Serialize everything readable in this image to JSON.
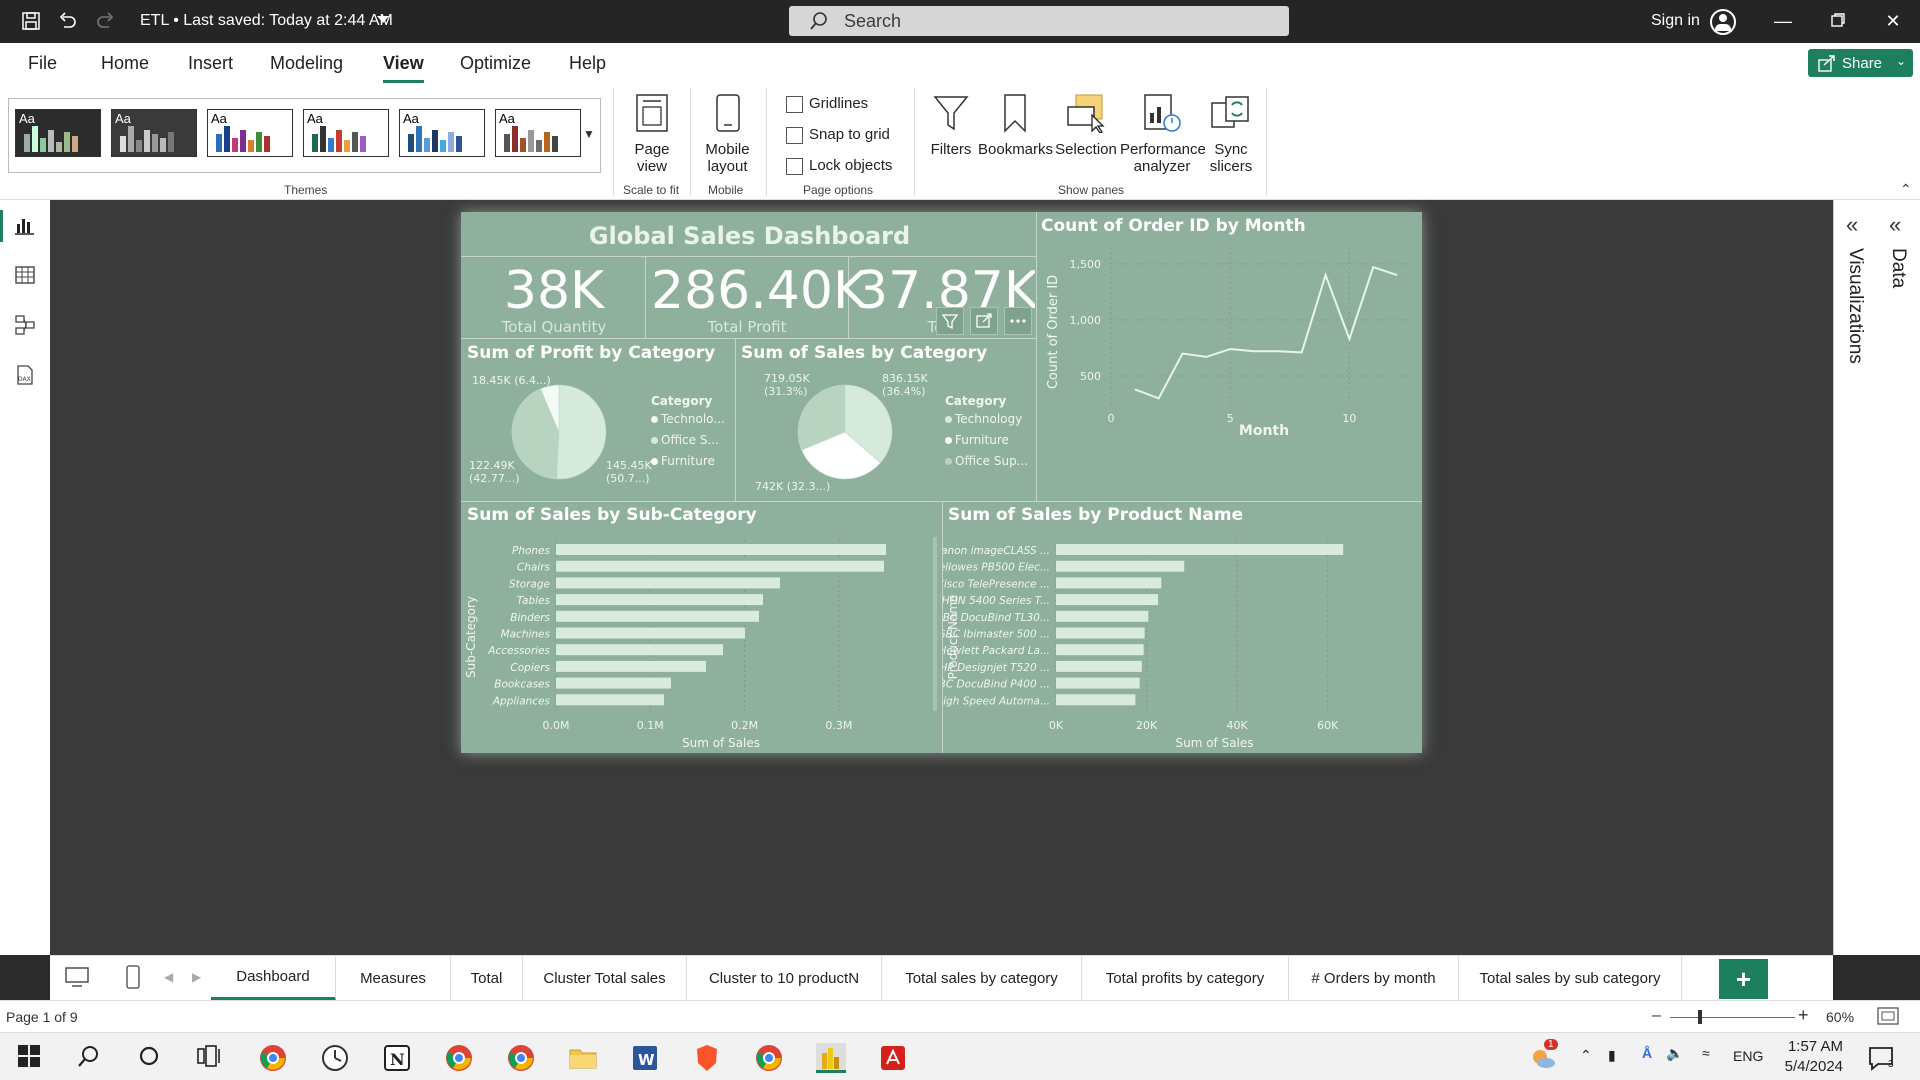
{
  "titlebar": {
    "doc_title": "ETL  •  Last saved: Today at 2:44 AM",
    "search_placeholder": "Search",
    "sign_in": "Sign in"
  },
  "ribbon": {
    "tabs": [
      "File",
      "Home",
      "Insert",
      "Modeling",
      "View",
      "Optimize",
      "Help"
    ],
    "active_tab": "View",
    "share_label": "Share",
    "theme_label": "Aa",
    "groups": {
      "themes": "Themes",
      "scale_to_fit": "Scale to fit",
      "mobile": "Mobile",
      "page_options": "Page options",
      "show_panes": "Show panes"
    },
    "page_view": "Page view",
    "mobile_layout": "Mobile layout",
    "checkboxes": [
      "Gridlines",
      "Snap to grid",
      "Lock objects"
    ],
    "panes": [
      "Filters",
      "Bookmarks",
      "Selection",
      "Performance analyzer",
      "Sync slicers"
    ]
  },
  "right_panes": {
    "visualizations": "Visualizations",
    "data": "Data"
  },
  "report": {
    "title": "Global Sales Dashboard",
    "kpis": [
      {
        "value": "38K",
        "label": "Total Quantity"
      },
      {
        "value": "286.40K",
        "label": "Total Profit"
      },
      {
        "value": "37.87K",
        "label": "Total"
      }
    ],
    "profit_by_category": {
      "title": "Sum of Profit by Category",
      "legend_title": "Category",
      "legend": [
        "Technolo...",
        "Office S...",
        "Furniture"
      ],
      "labels": [
        "18.45K (6.4...)",
        "122.49K (42.77...)",
        "145.45K (50.7...)"
      ]
    },
    "sales_by_category": {
      "title": "Sum of Sales by Category",
      "legend_title": "Category",
      "legend": [
        "Technology",
        "Furniture",
        "Office Sup..."
      ],
      "labels": [
        "719.05K (31.3%)",
        "836.15K (36.4%)",
        "742K (32.3...)"
      ]
    },
    "orders_by_month": {
      "title": "Count of Order ID by Month",
      "xlabel": "Month",
      "ylabel": "Count of Order ID",
      "yticks": [
        "1,500",
        "1,000",
        "500"
      ],
      "xticks": [
        "0",
        "5",
        "10"
      ]
    },
    "sales_by_subcategory": {
      "title": "Sum of Sales by Sub-Category",
      "xlabel": "Sum of Sales",
      "ylabel": "Sub-Category",
      "xticks": [
        "0.0M",
        "0.1M",
        "0.2M",
        "0.3M"
      ]
    },
    "sales_by_product": {
      "title": "Sum of Sales by Product Name",
      "xlabel": "Sum of Sales",
      "ylabel": "Product Name",
      "xticks": [
        "0K",
        "20K",
        "40K",
        "60K"
      ]
    }
  },
  "chart_data": [
    {
      "type": "pie",
      "title": "Sum of Profit by Category",
      "categories": [
        "Technology",
        "Office Supplies",
        "Furniture"
      ],
      "values": [
        145450,
        122490,
        18450
      ]
    },
    {
      "type": "pie",
      "title": "Sum of Sales by Category",
      "categories": [
        "Technology",
        "Furniture",
        "Office Supplies"
      ],
      "values": [
        836150,
        742000,
        719050
      ]
    },
    {
      "type": "line",
      "title": "Count of Order ID by Month",
      "xlabel": "Month",
      "ylabel": "Count of Order ID",
      "x": [
        1,
        2,
        3,
        4,
        5,
        6,
        7,
        8,
        9,
        10,
        11,
        12
      ],
      "values": [
        380,
        300,
        700,
        670,
        740,
        720,
        720,
        710,
        1400,
        830,
        1470,
        1400
      ],
      "xlim": [
        0,
        12.5
      ],
      "ylim": [
        250,
        1650
      ]
    },
    {
      "type": "bar",
      "orientation": "horizontal",
      "title": "Sum of Sales by Sub-Category",
      "xlabel": "Sum of Sales",
      "ylabel": "Sub-Category",
      "categories": [
        "Phones",
        "Chairs",
        "Storage",
        "Tables",
        "Binders",
        "Machines",
        "Accessories",
        "Copiers",
        "Bookcases",
        "Appliances"
      ],
      "values": [
        330000,
        328000,
        224000,
        207000,
        203000,
        189000,
        167000,
        150000,
        115000,
        108000
      ],
      "xlim": [
        0,
        330000
      ]
    },
    {
      "type": "bar",
      "orientation": "horizontal",
      "title": "Sum of Sales by Product Name",
      "xlabel": "Sum of Sales",
      "ylabel": "Product Name",
      "categories": [
        "Canon imageCLASS ...",
        "Fellowes PB500 Elec...",
        "Cisco TelePresence ...",
        "HON 5400 Series T...",
        "GBC DocuBind TL30...",
        "GBC Ibimaster 500 ...",
        "Hewlett Packard La...",
        "HP Designjet T520 ...",
        "GBC DocuBind P400 ...",
        "High Speed Automa..."
      ],
      "values": [
        61600,
        27500,
        22600,
        21900,
        19800,
        19000,
        18800,
        18400,
        17960,
        17030
      ],
      "xlim": [
        0,
        68000
      ]
    }
  ],
  "page_tabs": [
    "Dashboard",
    "Measures",
    "Total",
    "Cluster Total sales",
    "Cluster to 10 productN",
    "Total sales by category",
    "Total profits by category",
    "# Orders by month",
    "Total sales by sub category"
  ],
  "active_page": "Dashboard",
  "status": {
    "page_of": "Page 1 of 9",
    "zoom": "60%"
  },
  "taskbar": {
    "time": "1:57 AM",
    "date": "5/4/2024",
    "lang": "ENG",
    "badge": "1",
    "notif": "3"
  },
  "colors": {
    "accent": "#1e7f5c",
    "report_bg": "#8fb09d",
    "bar": "#d8ebdd"
  }
}
